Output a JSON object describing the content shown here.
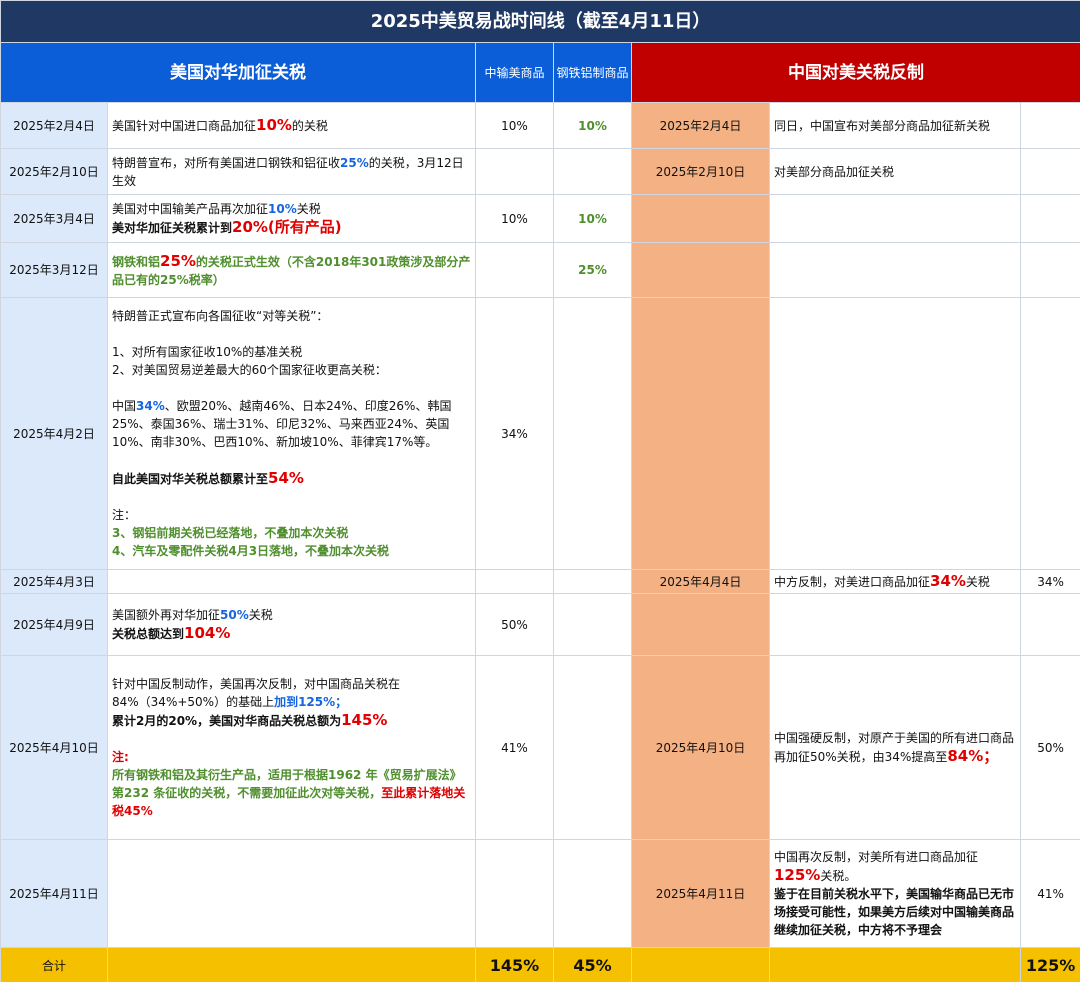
{
  "title": "2025中美贸易战时间线（截至4月11日）",
  "headers": {
    "us": "美国对华加征关税",
    "us_col_goods": "中输美商品",
    "us_col_steel": "钢铁铝制商品",
    "cn": "中国对美关税反制"
  },
  "rows": [
    {
      "us_date": "2025年2月4日",
      "us_lines": [
        [
          {
            "t": "美国针对中国进口商品加征"
          },
          {
            "t": "10%",
            "c": "red-big"
          },
          {
            "t": "的关税"
          }
        ]
      ],
      "us_goods": "10%",
      "us_steel": "10%",
      "cn_date": "2025年2月4日",
      "cn_lines": [
        [
          {
            "t": "同日，中国宣布对美部分商品加征新关税"
          }
        ]
      ],
      "cn_rate": ""
    },
    {
      "us_date": "2025年2月10日",
      "us_lines": [
        [
          {
            "t": "特朗普宣布，对所有美国进口钢铁和铝征收"
          },
          {
            "t": "25%",
            "c": "blue"
          },
          {
            "t": "的关税，3月12日生效"
          }
        ]
      ],
      "us_goods": "",
      "us_steel": "",
      "cn_date": "2025年2月10日",
      "cn_lines": [
        [
          {
            "t": "对美部分商品加征关税"
          }
        ]
      ],
      "cn_rate": ""
    },
    {
      "us_date": "2025年3月4日",
      "us_lines": [
        [
          {
            "t": "美国对中国输美产品再次加征"
          },
          {
            "t": "10%",
            "c": "blue"
          },
          {
            "t": "关税"
          }
        ],
        [
          {
            "t": "美对华加征关税累计到",
            "c": "bold"
          },
          {
            "t": "20%(所有产品)",
            "c": "red-big"
          }
        ]
      ],
      "us_goods": "10%",
      "us_steel": "10%",
      "cn_date": "",
      "cn_lines": [],
      "cn_rate": ""
    },
    {
      "us_date": "2025年3月12日",
      "us_lines": [
        [
          {
            "t": "钢铁和铝",
            "c": "green"
          },
          {
            "t": "25%",
            "c": "red-big"
          },
          {
            "t": "的关税正式生效（不含2018年301政策涉及部分产品已有的25%税率）",
            "c": "green"
          }
        ]
      ],
      "us_goods": "",
      "us_steel": "25%",
      "cn_date": "",
      "cn_lines": [],
      "cn_rate": ""
    },
    {
      "us_date": "2025年4月2日",
      "us_lines": [
        [
          {
            "t": "特朗普正式宣布向各国征收“对等关税”："
          }
        ],
        [],
        [
          {
            "t": "1、对所有国家征收10%的基准关税"
          }
        ],
        [
          {
            "t": "2、对美国贸易逆差最大的60个国家征收更高关税："
          }
        ],
        [],
        [
          {
            "t": "中国"
          },
          {
            "t": "34%",
            "c": "blue"
          },
          {
            "t": "、欧盟20%、越南46%、日本24%、印度26%、韩国25%、泰国36%、瑞士31%、印尼32%、马来西亚24%、英国10%、南非30%、巴西10%、新加坡10%、菲律宾17%等。"
          }
        ],
        [],
        [
          {
            "t": "自此美国对华关税总额累计至",
            "c": "bold"
          },
          {
            "t": "54%",
            "c": "red-big"
          }
        ],
        [],
        [
          {
            "t": "注："
          }
        ],
        [
          {
            "t": "3、钢铝前期关税已经落地，不叠加本次关税",
            "c": "green"
          }
        ],
        [
          {
            "t": "4、汽车及零配件关税4月3日落地，不叠加本次关税",
            "c": "green"
          }
        ]
      ],
      "us_goods": "34%",
      "us_steel": "",
      "cn_date": "",
      "cn_lines": [],
      "cn_rate": ""
    },
    {
      "us_date": "2025年4月3日",
      "us_lines": [],
      "us_goods": "",
      "us_steel": "",
      "cn_date": "2025年4月4日",
      "cn_lines": [
        [
          {
            "t": "中方反制，对美进口商品加征"
          },
          {
            "t": "34%",
            "c": "red-big"
          },
          {
            "t": "关税"
          }
        ]
      ],
      "cn_rate": "34%"
    },
    {
      "us_date": "2025年4月9日",
      "us_lines": [
        [
          {
            "t": "美国额外再对华加征"
          },
          {
            "t": "50%",
            "c": "blue"
          },
          {
            "t": "关税"
          }
        ],
        [
          {
            "t": "关税总额达到",
            "c": "bold"
          },
          {
            "t": "104%",
            "c": "red-big"
          }
        ]
      ],
      "us_goods": "50%",
      "us_steel": "",
      "cn_date": "",
      "cn_lines": [],
      "cn_rate": ""
    },
    {
      "us_date": "2025年4月10日",
      "us_lines": [
        [
          {
            "t": "针对中国反制动作，美国再次反制，对中国商品关税在84%（34%+50%）的基础上"
          },
          {
            "t": "加到125%；",
            "c": "blue"
          }
        ],
        [
          {
            "t": "累计2月的20%，美国对华商品关税总额为",
            "c": "bold"
          },
          {
            "t": "145%",
            "c": "red-big"
          }
        ],
        [],
        [
          {
            "t": "注:",
            "c": "red"
          }
        ],
        [
          {
            "t": "所有钢铁和铝及其衍生产品，适用于根据1962 年《贸易扩展法》第232 条征收的关税，不需要加征此次对等关税，",
            "c": "green"
          },
          {
            "t": "至此累计落地关税45%",
            "c": "red"
          }
        ]
      ],
      "us_goods": "41%",
      "us_steel": "",
      "cn_date": "2025年4月10日",
      "cn_lines": [
        [
          {
            "t": "中国强硬反制，对原产于美国的所有进口商品再加征50%关税，由34%提高至"
          },
          {
            "t": "84%；",
            "c": "red-big"
          }
        ]
      ],
      "cn_rate": "50%"
    },
    {
      "us_date": "2025年4月11日",
      "us_lines": [],
      "us_goods": "",
      "us_steel": "",
      "cn_date": "2025年4月11日",
      "cn_lines": [
        [
          {
            "t": "中国再次反制，对美所有进口商品加征"
          }
        ],
        [
          {
            "t": "125%",
            "c": "red-big"
          },
          {
            "t": "关税。"
          }
        ],
        [
          {
            "t": "鉴于在目前关税水平下，美国输华商品已无市场接受可能性，如果美方后续对中国输美商品继续加征关税，中方将不予理会",
            "c": "bold"
          }
        ]
      ],
      "cn_rate": "41%"
    }
  ],
  "total": {
    "label": "合计",
    "us_goods": "145%",
    "us_steel": "45%",
    "cn_rate": "125%"
  },
  "colors": {
    "title_bg": "#1f3864",
    "us_header": "#0b5ed7",
    "cn_header": "#c00000",
    "us_date_bg": "#dbe9fa",
    "cn_date_bg": "#f4b183",
    "total_bg": "#f5c000",
    "emphasis_red": "#e00000",
    "emphasis_blue": "#1565e0",
    "emphasis_green": "#4f8f2e"
  }
}
